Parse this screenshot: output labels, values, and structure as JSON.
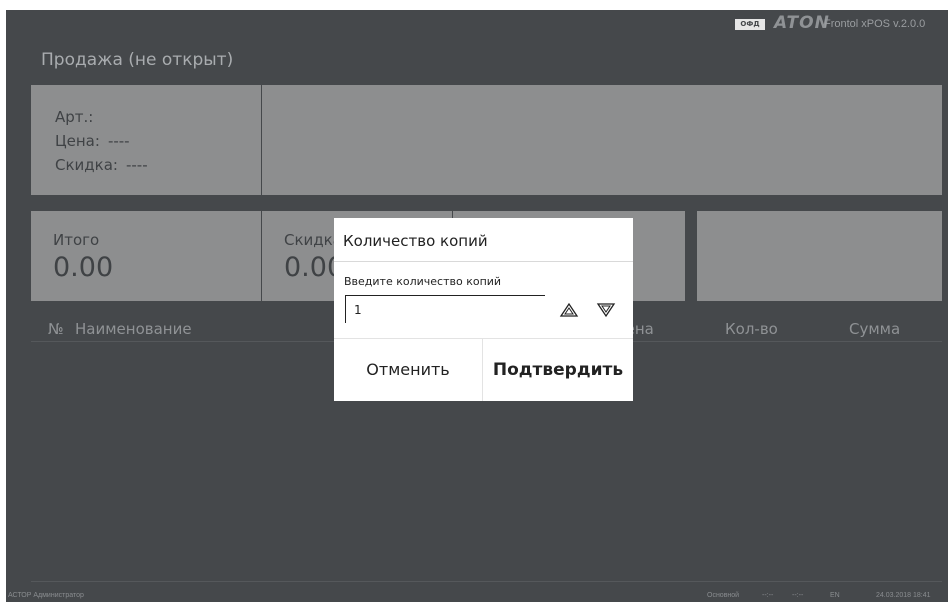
{
  "header": {
    "ofd_badge": "ОФД",
    "brand": "ATON",
    "version": "Frontol xPOS v.2.0.0"
  },
  "page_title": "Продажа (не открыт)",
  "item_info": {
    "article_label": "Арт.:",
    "article_value": "",
    "price_label": "Цена:",
    "price_value": "----",
    "discount_label": "Скидка:",
    "discount_value": "----"
  },
  "totals": {
    "total_label": "Итого",
    "total_value": "0.00",
    "discount_label": "Скидка",
    "discount_value": "0.00"
  },
  "table": {
    "columns": [
      "№",
      "Наименование",
      "Цена",
      "Кол-во",
      "Сумма"
    ]
  },
  "status_bar": {
    "user": "АСТОР Администратор",
    "mode": "Основной",
    "field1": "--:--",
    "field2": "--:--",
    "lang": "EN",
    "datetime": "24.03.2018 18:41"
  },
  "dialog": {
    "title": "Количество копий",
    "prompt": "Введите количество копий",
    "value": "1",
    "cancel_label": "Отменить",
    "confirm_label": "Подтвердить"
  },
  "icons": {
    "step_up": "triangle-up-outline-icon",
    "step_down": "triangle-down-outline-icon"
  },
  "colors": {
    "background": "#45484b",
    "panel": "#8d8e8f",
    "dialog": "#ffffff"
  }
}
